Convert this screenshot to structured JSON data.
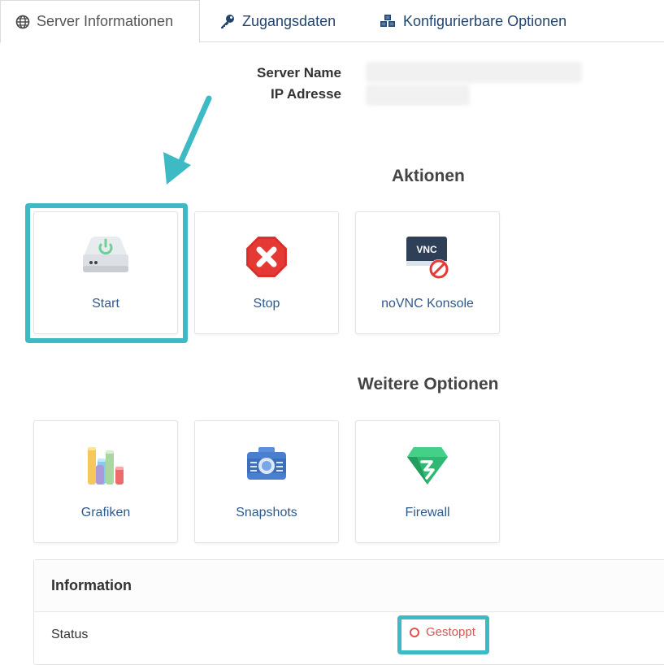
{
  "tabs": [
    {
      "label": "Server Informationen",
      "icon": "globe-icon",
      "active": true
    },
    {
      "label": "Zugangsdaten",
      "icon": "key-icon",
      "active": false
    },
    {
      "label": "Konfigurierbare Optionen",
      "icon": "cubes-icon",
      "active": false
    }
  ],
  "server": {
    "name_label": "Server Name",
    "ip_label": "IP Adresse"
  },
  "actions": {
    "title": "Aktionen",
    "items": [
      {
        "label": "Start",
        "icon": "power-drive-icon"
      },
      {
        "label": "Stop",
        "icon": "stop-sign-icon"
      },
      {
        "label": "noVNC Konsole",
        "icon": "vnc-disabled-icon"
      }
    ]
  },
  "options": {
    "title": "Weitere Optionen",
    "items": [
      {
        "label": "Grafiken",
        "icon": "bar-chart-icon"
      },
      {
        "label": "Snapshots",
        "icon": "camera-icon"
      },
      {
        "label": "Firewall",
        "icon": "shield-gem-icon"
      }
    ]
  },
  "information": {
    "title": "Information",
    "status_label": "Status",
    "status_value": "Gestoppt"
  },
  "colors": {
    "accent": "#3dbac4",
    "link": "#2f5a8e",
    "stopped": "#e05252"
  }
}
